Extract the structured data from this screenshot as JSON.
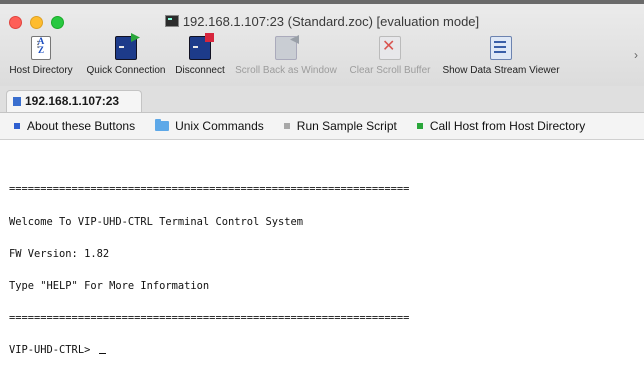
{
  "window": {
    "title": "192.168.1.107:23 (Standard.zoc) [evaluation mode]"
  },
  "toolbar": {
    "items": [
      {
        "label": "Host Directory",
        "icon": "host-directory-icon",
        "enabled": true
      },
      {
        "label": "Quick Connection",
        "icon": "quick-connection-icon",
        "enabled": true
      },
      {
        "label": "Disconnect",
        "icon": "disconnect-icon",
        "enabled": true
      },
      {
        "label": "Scroll Back as Window",
        "icon": "scroll-back-icon",
        "enabled": false
      },
      {
        "label": "Clear Scroll Buffer",
        "icon": "clear-scroll-buffer-icon",
        "enabled": false
      },
      {
        "label": "Show Data Stream Viewer",
        "icon": "data-stream-viewer-icon",
        "enabled": true
      }
    ],
    "overflow": "›"
  },
  "tabs": [
    {
      "label": "192.168.1.107:23",
      "active": true
    }
  ],
  "userbar": {
    "items": [
      {
        "label": "About these Buttons",
        "color": "#2f5fd0"
      },
      {
        "label": "Unix Commands",
        "color": "#5da8e8"
      },
      {
        "label": "Run Sample Script",
        "color": "#a8a8a8"
      },
      {
        "label": "Call Host from Host Directory",
        "color": "#2aa63a"
      }
    ]
  },
  "terminal": {
    "lines": [
      "================================================================",
      "Welcome To VIP-UHD-CTRL Terminal Control System",
      "FW Version: 1.82",
      "Type \"HELP\" For More Information",
      "================================================================"
    ],
    "prompt": "VIP-UHD-CTRL> "
  }
}
